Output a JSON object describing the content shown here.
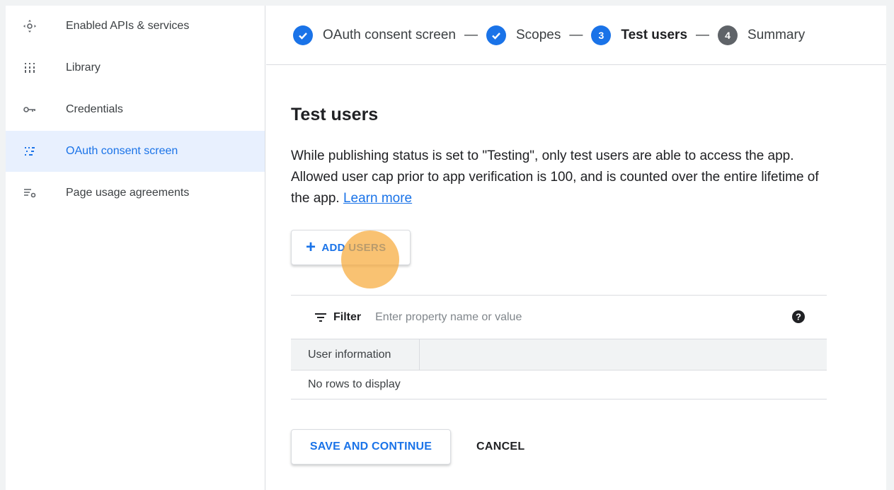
{
  "sidebar": {
    "items": [
      {
        "label": "Enabled APIs & services",
        "icon": "api-hub-icon",
        "active": false
      },
      {
        "label": "Library",
        "icon": "library-grid-icon",
        "active": false
      },
      {
        "label": "Credentials",
        "icon": "key-icon",
        "active": false
      },
      {
        "label": "OAuth consent screen",
        "icon": "consent-dots-icon",
        "active": true
      },
      {
        "label": "Page usage agreements",
        "icon": "settings-list-icon",
        "active": false
      }
    ]
  },
  "stepper": {
    "steps": [
      {
        "label": "OAuth consent screen",
        "state": "done"
      },
      {
        "label": "Scopes",
        "state": "done"
      },
      {
        "number": "3",
        "label": "Test users",
        "state": "current"
      },
      {
        "number": "4",
        "label": "Summary",
        "state": "pending"
      }
    ],
    "separator": "—"
  },
  "main": {
    "title": "Test users",
    "description": "While publishing status is set to \"Testing\", only test users are able to access the app. Allowed user cap prior to app verification is 100, and is counted over the entire lifetime of the app.",
    "learn_more": "Learn more",
    "add_users_label": "ADD USERS",
    "add_users_icon": "+"
  },
  "table": {
    "filter_label": "Filter",
    "filter_placeholder": "Enter property name or value",
    "column_header": "User information",
    "empty_message": "No rows to display"
  },
  "actions": {
    "save_label": "SAVE AND CONTINUE",
    "cancel_label": "CANCEL"
  },
  "colors": {
    "accent": "#1a73e8",
    "active_bg": "#e8f0fe",
    "click_indicator": "#f7aa3c"
  }
}
